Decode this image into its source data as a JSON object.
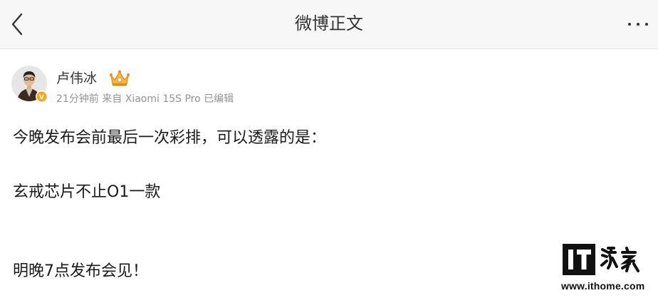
{
  "header": {
    "title": "微博正文",
    "back_icon": "chevron-left-icon",
    "more_icon": "ellipsis-icon"
  },
  "post": {
    "author": {
      "name": "卢伟冰",
      "avatar_icon": "user-avatar",
      "verified_icon": "verified-badge-icon",
      "member_icon": "crown-icon",
      "verified_color": "#f5a623"
    },
    "meta": "21分钟前 来自 Xiaomi 15S Pro 已编辑",
    "lines": [
      "今晚发布会前最后一次彩排，可以透露的是：",
      "玄戒芯片不止O1一款",
      "明晚7点发布会见！"
    ]
  },
  "watermark": {
    "logo_text": "IT之家",
    "url": "www.ithome.com"
  }
}
